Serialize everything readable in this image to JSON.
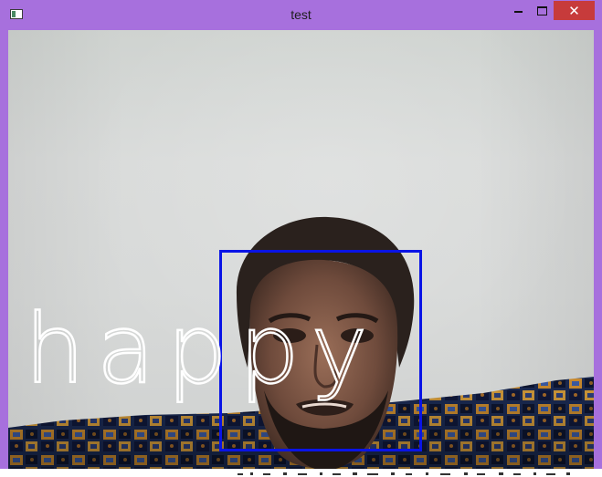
{
  "window": {
    "title": "test",
    "close_glyph": "✕",
    "accent_color": "#a770dd",
    "close_color": "#c73b3b"
  },
  "camera": {
    "emotion_label": "happy",
    "box_color": "#0a14e6",
    "label_color": "#ffffff"
  },
  "icons": {
    "app": "app-window-icon",
    "minimize": "minimize-icon",
    "maximize": "maximize-icon",
    "close": "close-icon"
  }
}
